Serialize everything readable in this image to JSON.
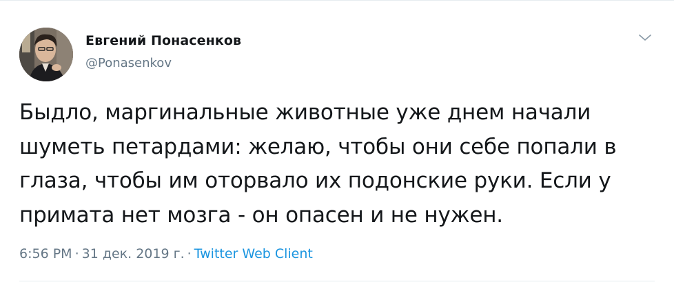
{
  "author": {
    "name": "Евгений Понасенков",
    "handle": "@Ponasenkov"
  },
  "tweet": {
    "text": "Быдло, маргинальные животные уже днем начали\nшуметь петардами: желаю, чтобы они себе попали в\nглаза, чтобы им оторвало их подонские руки. Если у\nпримата нет мозга - он опасен и не нужен."
  },
  "meta": {
    "time": "6:56 PM",
    "separator": "·",
    "date": "31 дек. 2019 г.",
    "client": "Twitter Web Client"
  },
  "icons": {
    "menu": "chevron-down-icon"
  },
  "colors": {
    "text": "#14171a",
    "secondary": "#657786",
    "link": "#1b95e0",
    "border": "#e6ecf0"
  }
}
